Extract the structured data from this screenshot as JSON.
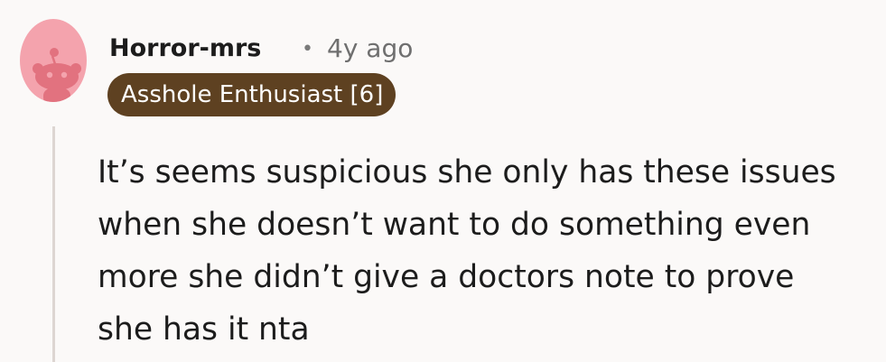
{
  "comment": {
    "username": "Horror-mrs",
    "separator": "•",
    "timestamp": "4y ago",
    "flair": "Asshole Enthusiast [6]",
    "body_lines": [
      "It’s seems suspicious she only has these issues",
      "when she doesn’t want to do something even",
      "more she didn’t give a doctors note to prove",
      "she has it nta"
    ]
  },
  "avatar": {
    "icon": "reddit-snoo-avatar-icon",
    "background_color": "#f4a3ad"
  },
  "colors": {
    "flair_background": "#5e4121",
    "thread_line": "#ddd6d2"
  }
}
